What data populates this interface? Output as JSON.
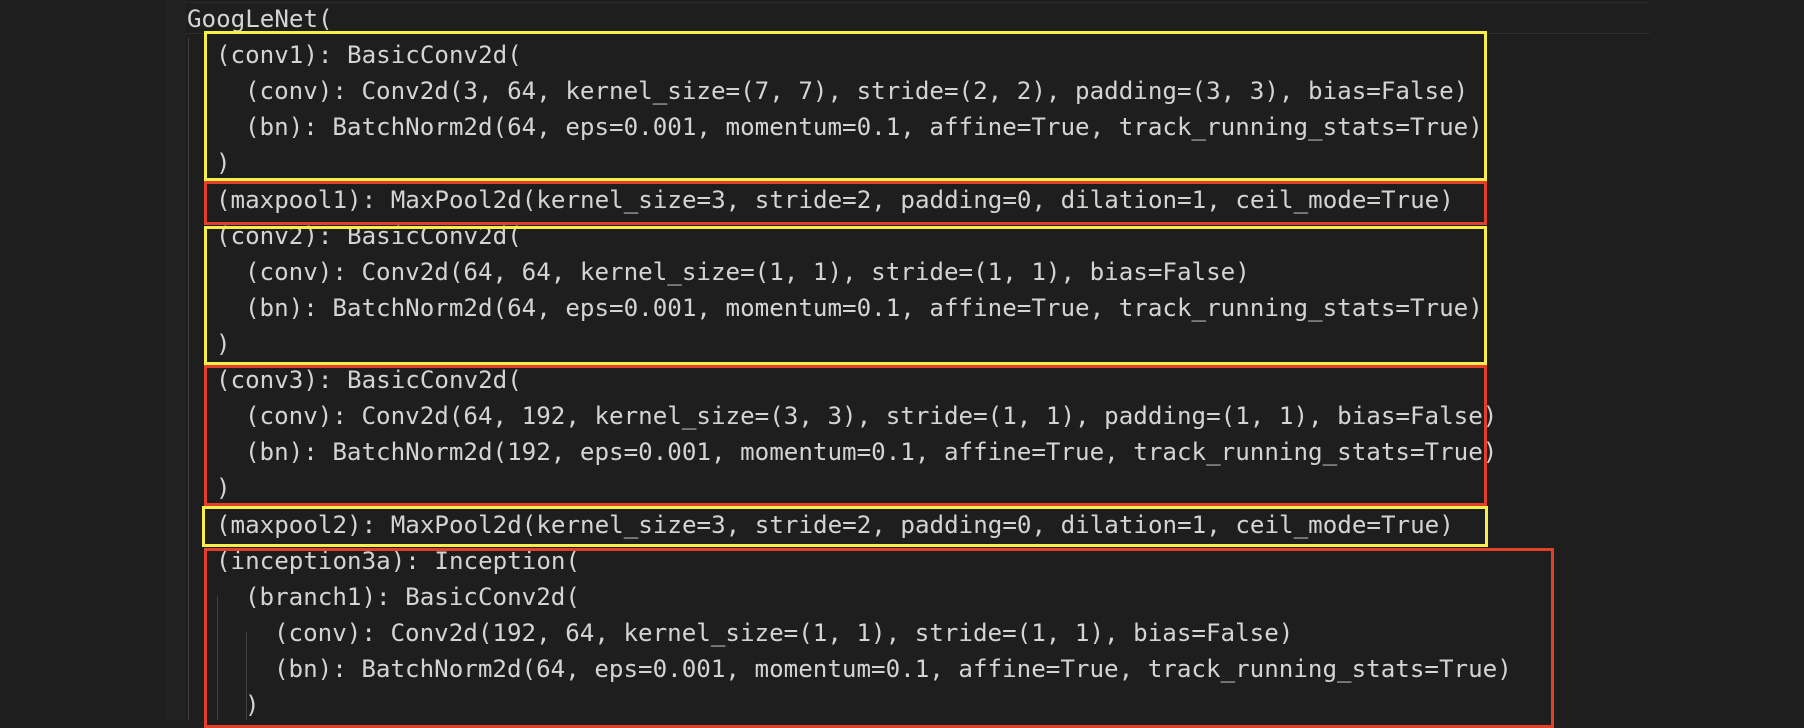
{
  "lines": [
    "GoogLeNet(",
    "(conv1): BasicConv2d(",
    "(conv): Conv2d(3, 64, kernel_size=(7, 7), stride=(2, 2), padding=(3, 3), bias=False)",
    "(bn): BatchNorm2d(64, eps=0.001, momentum=0.1, affine=True, track_running_stats=True)",
    ")",
    "(maxpool1): MaxPool2d(kernel_size=3, stride=2, padding=0, dilation=1, ceil_mode=True)",
    "(conv2): BasicConv2d(",
    "(conv): Conv2d(64, 64, kernel_size=(1, 1), stride=(1, 1), bias=False)",
    "(bn): BatchNorm2d(64, eps=0.001, momentum=0.1, affine=True, track_running_stats=True)",
    ")",
    "(conv3): BasicConv2d(",
    "(conv): Conv2d(64, 192, kernel_size=(3, 3), stride=(1, 1), padding=(1, 1), bias=False)",
    "(bn): BatchNorm2d(192, eps=0.001, momentum=0.1, affine=True, track_running_stats=True)",
    ")",
    "(maxpool2): MaxPool2d(kernel_size=3, stride=2, padding=0, dilation=1, ceil_mode=True)",
    "(inception3a): Inception(",
    "(branch1): BasicConv2d(",
    "(conv): Conv2d(192, 64, kernel_size=(1, 1), stride=(1, 1), bias=False)",
    "(bn): BatchNorm2d(64, eps=0.001, momentum=0.1, affine=True, track_running_stats=True)",
    ")"
  ],
  "colors": {
    "editor_background": "#1e1e1e",
    "text": "#d4d4d4",
    "highlight_yellow": "#f6ef49",
    "highlight_red": "#e2402b"
  }
}
